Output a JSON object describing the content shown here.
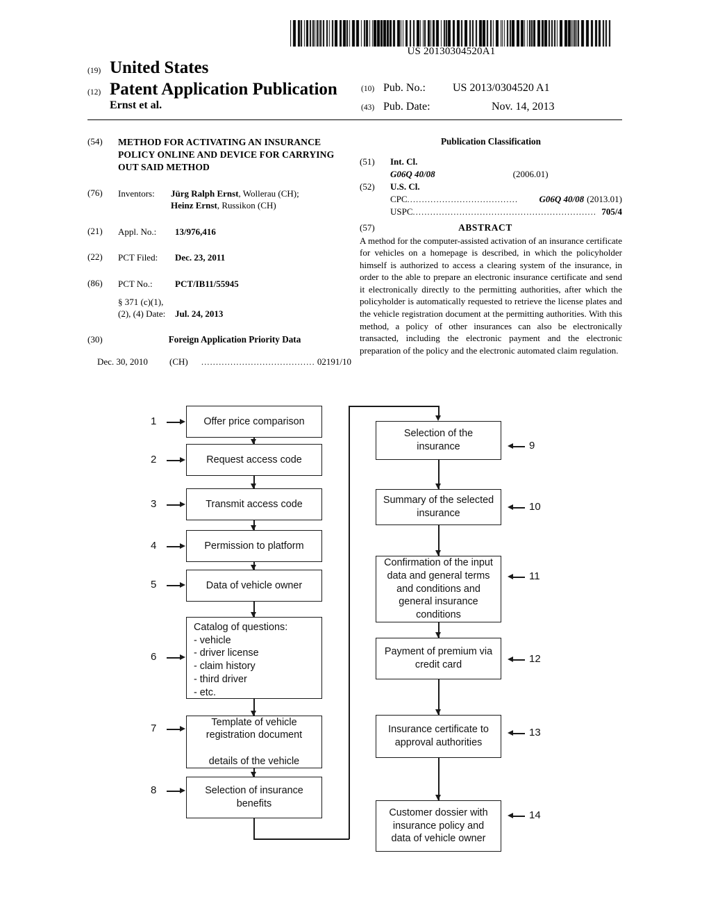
{
  "barcode": {
    "number": "US 20130304520A1"
  },
  "header": {
    "kind_19": "(19)",
    "country": "United States",
    "kind_12": "(12)",
    "doc_type": "Patent Application Publication",
    "authors": "Ernst et al.",
    "pub_no_code": "(10)",
    "pub_no_label": "Pub. No.:",
    "pub_no_value": "US 2013/0304520 A1",
    "pub_date_code": "(43)",
    "pub_date_label": "Pub. Date:",
    "pub_date_value": "Nov. 14, 2013"
  },
  "left_column": {
    "title_code": "(54)",
    "title": "METHOD FOR ACTIVATING AN INSURANCE POLICY ONLINE AND DEVICE FOR CARRYING OUT SAID METHOD",
    "inventors_code": "(76)",
    "inventors_label": "Inventors:",
    "inventor_1_name": "Jürg Ralph Ernst",
    "inventor_1_location": ", Wollerau (CH);",
    "inventor_2_name": "Heinz Ernst",
    "inventor_2_location": ", Russikon (CH)",
    "appl_no_code": "(21)",
    "appl_no_label": "Appl. No.:",
    "appl_no_value": "13/976,416",
    "pct_filed_code": "(22)",
    "pct_filed_label": "PCT Filed:",
    "pct_filed_value": "Dec. 23, 2011",
    "pct_no_code": "(86)",
    "pct_no_label": "PCT No.:",
    "pct_no_value": "PCT/IB11/55945",
    "sect371_line1": "§ 371 (c)(1),",
    "sect371_line2": "(2), (4) Date:",
    "sect371_value": "Jul. 24, 2013",
    "foreign_code": "(30)",
    "foreign_title": "Foreign Application Priority Data",
    "priority_date": "Dec. 30, 2010",
    "priority_country": "(CH)",
    "priority_dots": "........................................",
    "priority_number": "02191/10"
  },
  "right_column": {
    "pub_class_title": "Publication Classification",
    "int_cl_code": "(51)",
    "int_cl_label": "Int. Cl.",
    "int_cl_value": "G06Q 40/08",
    "int_cl_date": "(2006.01)",
    "us_cl_code": "(52)",
    "us_cl_label": "U.S. Cl.",
    "cpc_key": "CPC",
    "cpc_dots": "......................................",
    "cpc_value": "G06Q 40/08",
    "cpc_date": "(2013.01)",
    "uspc_key": "USPC",
    "uspc_dots": "...............................................................",
    "uspc_value": "705/4",
    "abstract_code": "(57)",
    "abstract_title": "ABSTRACT",
    "abstract_text": "A method for the computer-assisted activation of an insurance certificate for vehicles on a homepage is described, in which the policyholder himself is authorized to access a clearing system of the insurance, in order to the able to prepare an electronic insurance certificate and send it electronically directly to the permitting authorities, after which the policyholder is automatically requested to retrieve the license plates and the vehicle registration document at the permitting authorities. With this method, a policy of other insurances can also be electronically transacted, including the electronic payment and the electronic preparation of the policy and the electronic automated claim regulation."
  },
  "figure": {
    "nodes": [
      {
        "ref": "1",
        "text": "Offer price comparison"
      },
      {
        "ref": "2",
        "text": "Request access code"
      },
      {
        "ref": "3",
        "text": "Transmit access code"
      },
      {
        "ref": "4",
        "text": "Permission to platform"
      },
      {
        "ref": "5",
        "text": "Data of vehicle owner"
      },
      {
        "ref": "6",
        "text": "Catalog of questions:\n- vehicle\n- driver license\n- claim history\n- third driver\n- etc."
      },
      {
        "ref": "7",
        "text": "Template of vehicle\nregistration document\n\ndetails of the vehicle"
      },
      {
        "ref": "8",
        "text": "Selection of insurance\nbenefits"
      },
      {
        "ref": "9",
        "text": "Selection of the\ninsurance"
      },
      {
        "ref": "10",
        "text": "Summary of the selected\ninsurance"
      },
      {
        "ref": "11",
        "text": "Confirmation of the input\ndata and general terms\nand conditions and\ngeneral insurance\nconditions"
      },
      {
        "ref": "12",
        "text": "Payment of premium via\ncredit card"
      },
      {
        "ref": "13",
        "text": "Insurance certificate to\napproval authorities"
      },
      {
        "ref": "14",
        "text": "Customer dossier with\ninsurance policy and\ndata of vehicle owner"
      }
    ]
  }
}
